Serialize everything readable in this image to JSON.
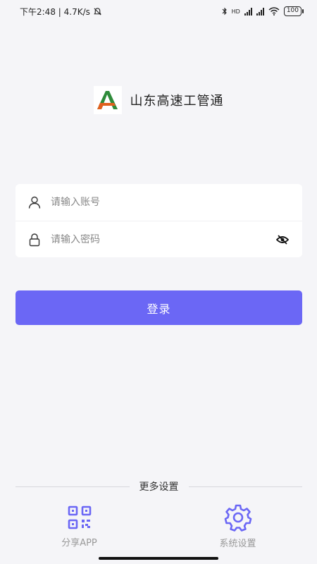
{
  "status_bar": {
    "time_speed": "下午2:48 | 4.7K/s",
    "battery": "100",
    "network_type": "HD"
  },
  "brand": {
    "title": "山东高速工管通",
    "logo_icon": "sdhs-logo-icon"
  },
  "form": {
    "account_placeholder": "请输入账号",
    "password_placeholder": "请输入密码",
    "account_icon": "user-icon",
    "password_icon": "lock-icon",
    "toggle_icon": "eye-off-icon"
  },
  "login": {
    "label": "登录"
  },
  "more": {
    "label": "更多设置"
  },
  "actions": [
    {
      "label": "分享APP",
      "icon": "qr-code-icon"
    },
    {
      "label": "系统设置",
      "icon": "gear-icon"
    }
  ],
  "colors": {
    "accent": "#6b67f5",
    "background": "#f5f5f8",
    "logo_green": "#2e8b3a",
    "logo_orange": "#e0601e"
  }
}
